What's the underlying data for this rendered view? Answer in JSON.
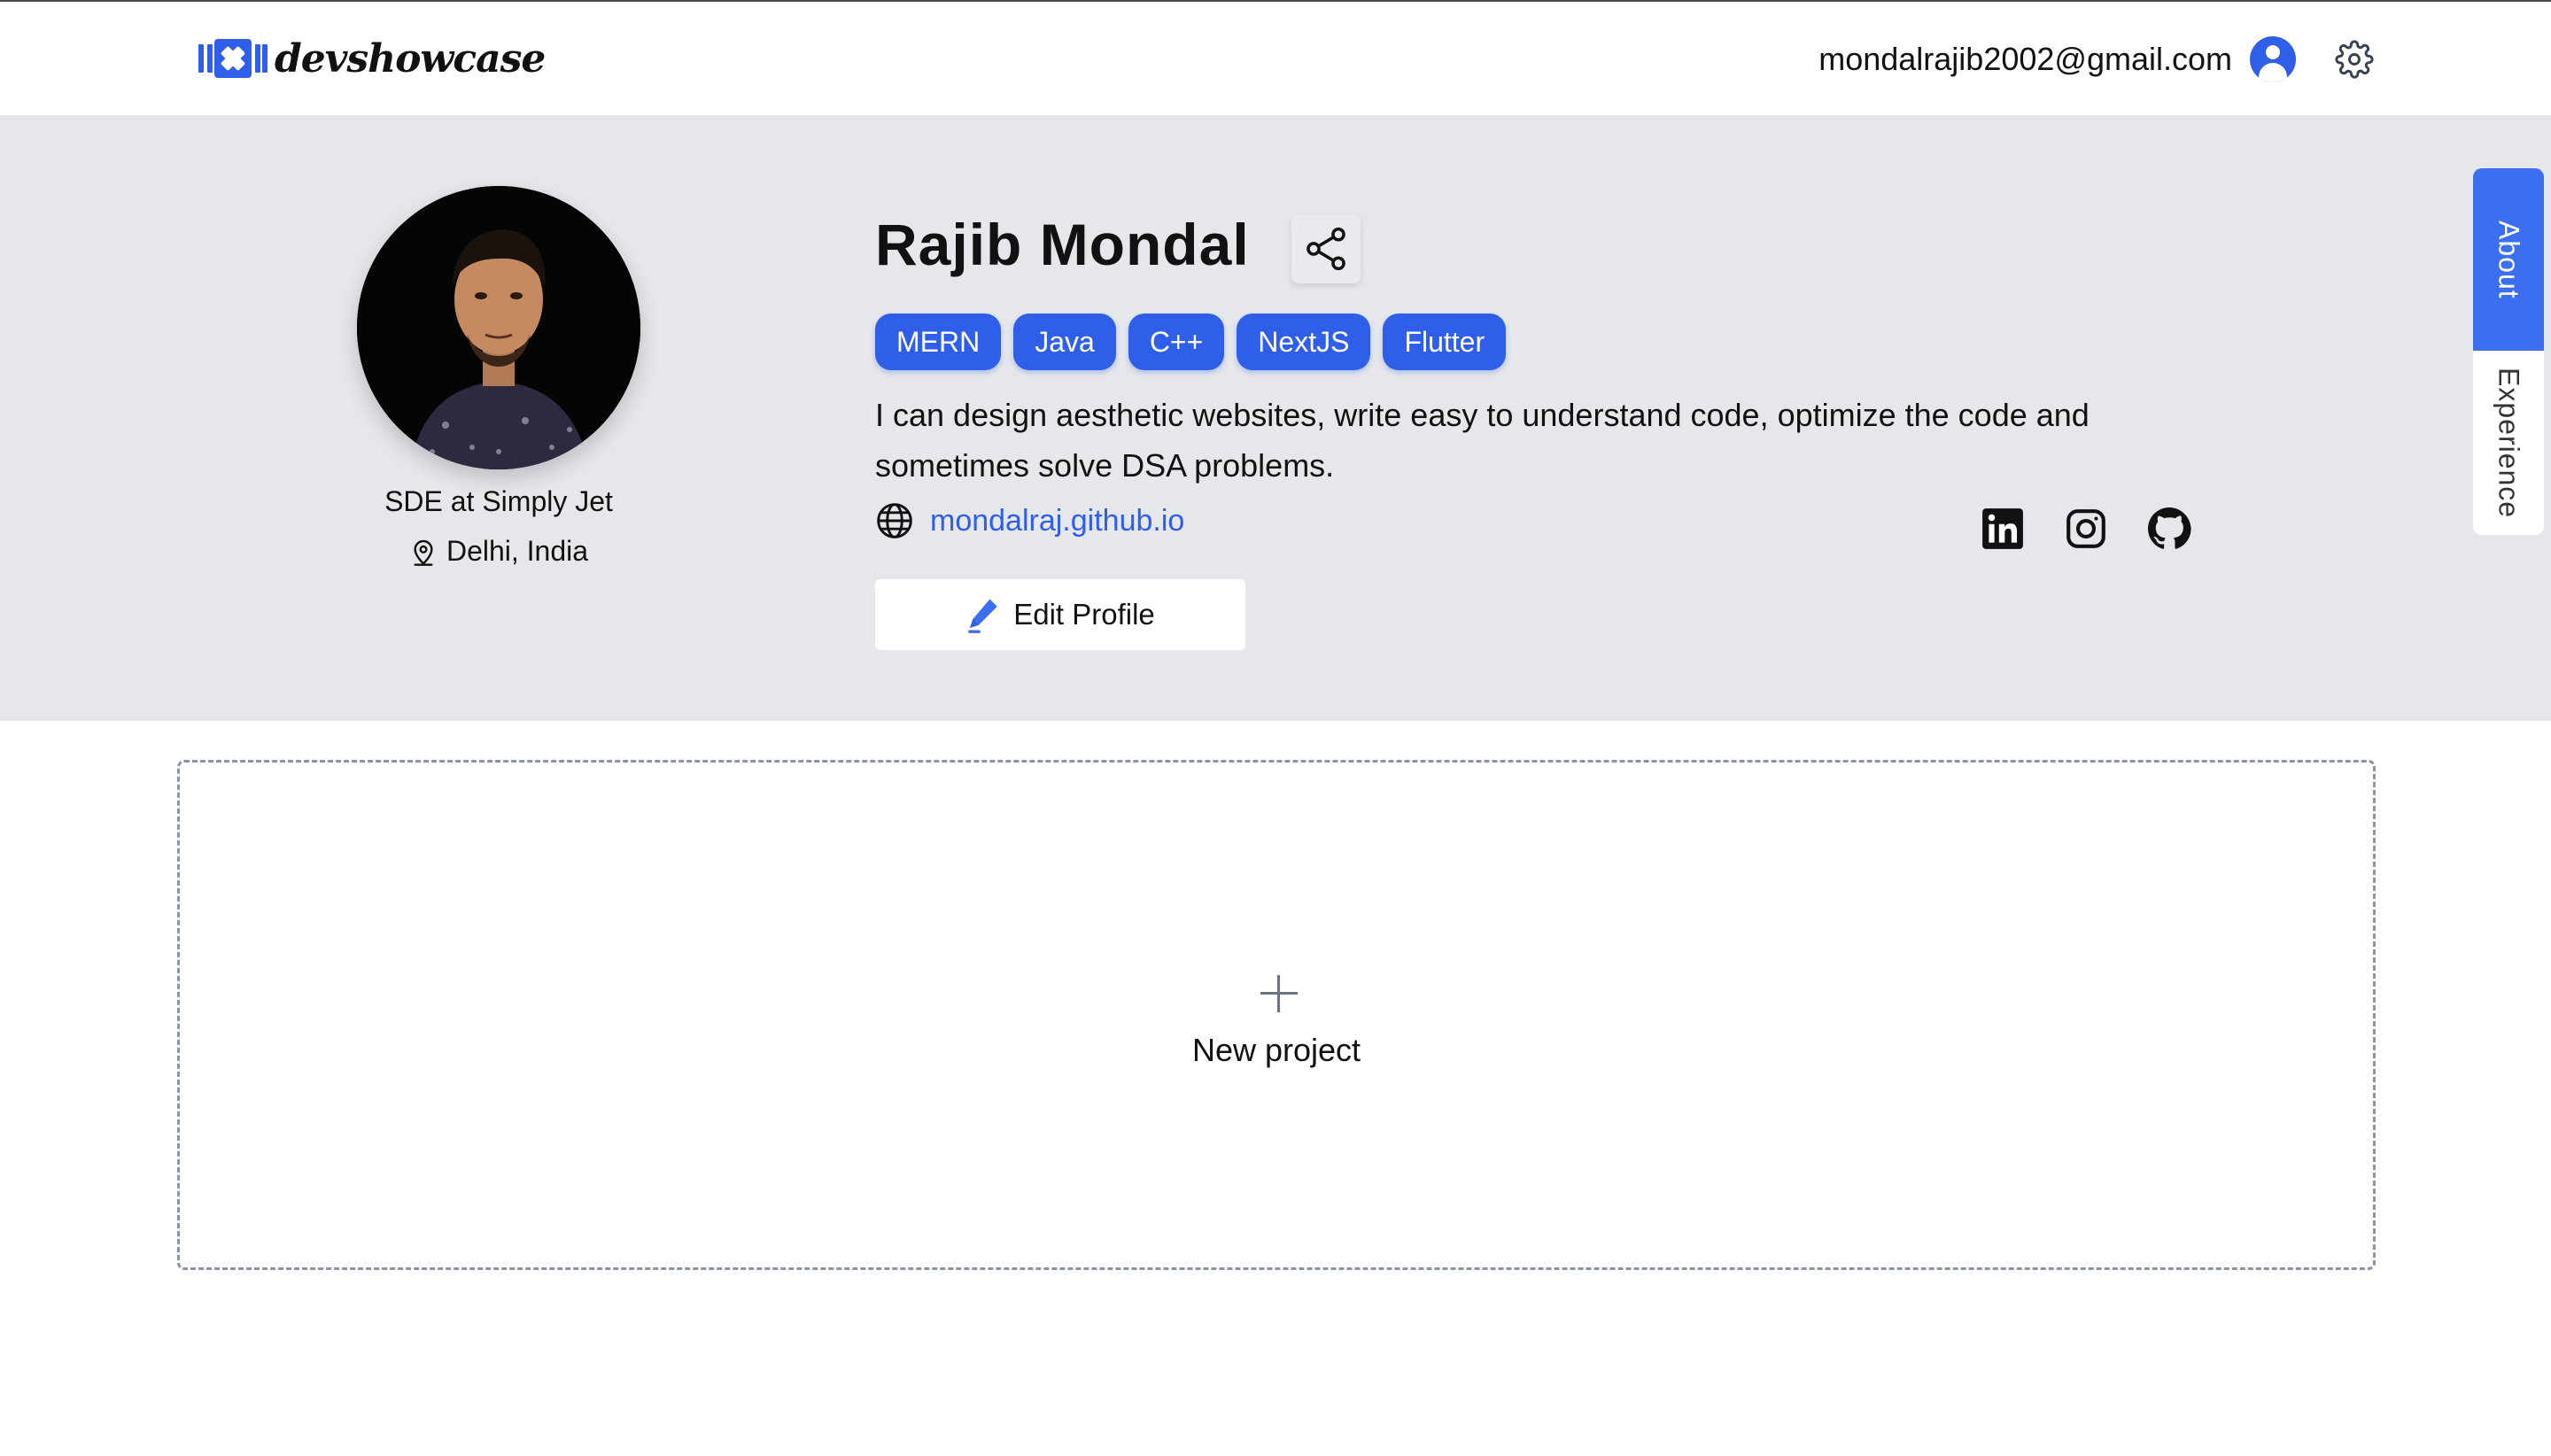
{
  "header": {
    "logo_text": "devshowcase",
    "email": "mondalrajib2002@gmail.com",
    "avatar_icon": "user-circle-icon",
    "settings_icon": "gear-icon"
  },
  "profile": {
    "name": "Rajib Mondal",
    "role": "SDE at Simply Jet",
    "location": "Delhi, India",
    "tags": [
      "MERN",
      "Java",
      "C++",
      "NextJS",
      "Flutter"
    ],
    "bio": "I can design aesthetic websites, write easy to understand code, optimize the code and sometimes solve DSA problems.",
    "website": "mondalraj.github.io",
    "edit_label": "Edit Profile",
    "socials": [
      "linkedin-icon",
      "instagram-icon",
      "github-icon"
    ]
  },
  "side_tabs": {
    "about": "About",
    "experience": "Experience"
  },
  "new_project": {
    "label": "New project"
  },
  "colors": {
    "accent": "#2f5ee8",
    "band_bg": "#e5e7eb",
    "dashed_border": "#8a94a6"
  }
}
